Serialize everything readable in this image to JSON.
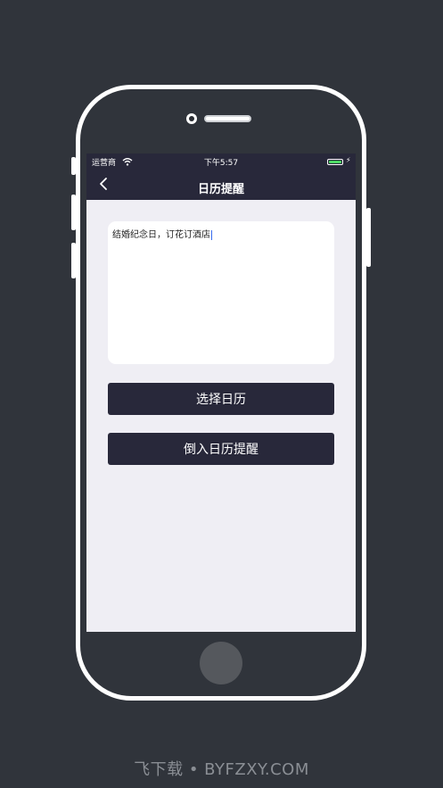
{
  "status_bar": {
    "carrier": "运营商",
    "time": "下午5:57",
    "battery_level": 1.0,
    "charging": true
  },
  "nav": {
    "title": "日历提醒",
    "back_icon": "chevron-left-icon"
  },
  "reminder_text": "结婚纪念日，订花订酒店",
  "buttons": {
    "select_calendar": "选择日历",
    "import_reminder": "倒入日历提醒"
  },
  "watermark": "飞下载 • BYFZXY.COM",
  "colors": {
    "background": "#30343b",
    "nav_bar": "#28283a",
    "screen_bg": "#efeef4",
    "button_bg": "#28283a",
    "battery_green": "#4cd964"
  }
}
